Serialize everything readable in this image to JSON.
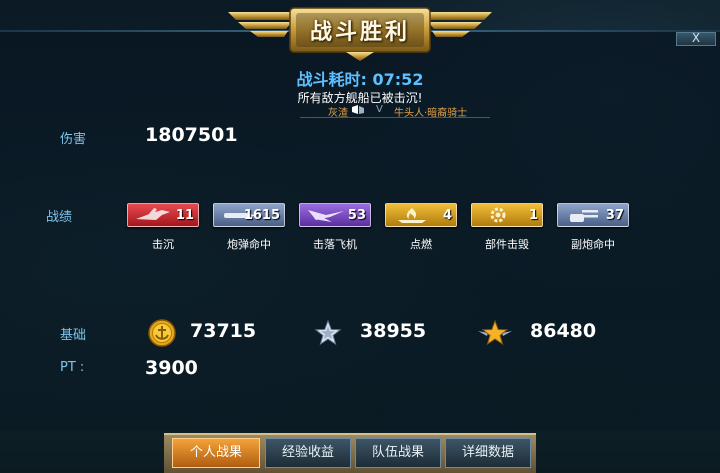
{
  "header": {
    "title": "战斗胜利",
    "close_glyph": "X"
  },
  "summary": {
    "duration": "战斗耗时: 07:52",
    "result_message": "所有敌方舰船已被击沉!",
    "left_player": "灰渣",
    "vs": "V",
    "right_player": "牛头人·暗裔骑士"
  },
  "damage": {
    "label": "伤害",
    "value": "1807501"
  },
  "achievements": {
    "label": "战绩",
    "items": [
      {
        "name": "击沉",
        "count": "11",
        "color": "#c0262b",
        "icon": "plane-sunk-icon"
      },
      {
        "name": "炮弹命中",
        "count": "1615",
        "color": "#5a6f97",
        "icon": "shell-icon"
      },
      {
        "name": "击落飞机",
        "count": "53",
        "color": "#6d43b5",
        "icon": "aircraft-icon"
      },
      {
        "name": "点燃",
        "count": "4",
        "color": "#d79a13",
        "icon": "fire-icon"
      },
      {
        "name": "部件击毁",
        "count": "1",
        "color": "#d79a13",
        "icon": "gear-icon"
      },
      {
        "name": "副炮命中",
        "count": "37",
        "color": "#5a6f97",
        "icon": "turret-icon"
      }
    ]
  },
  "rewards": {
    "label": "基础",
    "credits": "73715",
    "exp": "38955",
    "free_exp": "86480",
    "pt_label": "PT :",
    "pt_value": "3900"
  },
  "tabs": [
    {
      "label": "个人战果",
      "active": true
    },
    {
      "label": "经验收益",
      "active": false
    },
    {
      "label": "队伍战果",
      "active": false
    },
    {
      "label": "详细数据",
      "active": false
    }
  ]
}
